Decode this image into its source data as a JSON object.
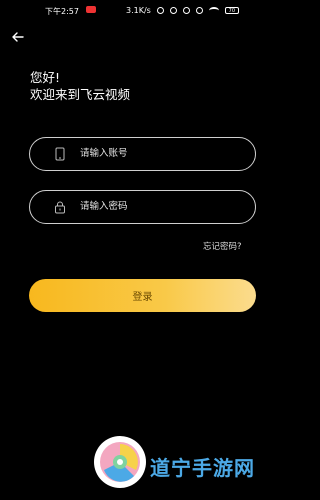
{
  "status_bar": {
    "time": "下午2:57",
    "network_speed": "3.1K/s",
    "battery": "70"
  },
  "greeting": {
    "line1": "您好!",
    "line2": "欢迎来到飞云视频"
  },
  "account_field": {
    "placeholder": "请输入账号",
    "icon": "phone-icon"
  },
  "password_field": {
    "placeholder": "请输入密码",
    "icon": "lock-icon"
  },
  "forgot_password": "忘记密码?",
  "login_button": "登录",
  "watermark": {
    "text": "道宁手游网"
  },
  "colors": {
    "background": "#000000",
    "button_gradient_start": "#f8b81e",
    "button_gradient_end": "#fbdc8e",
    "watermark_text": "#4ca9e6"
  }
}
